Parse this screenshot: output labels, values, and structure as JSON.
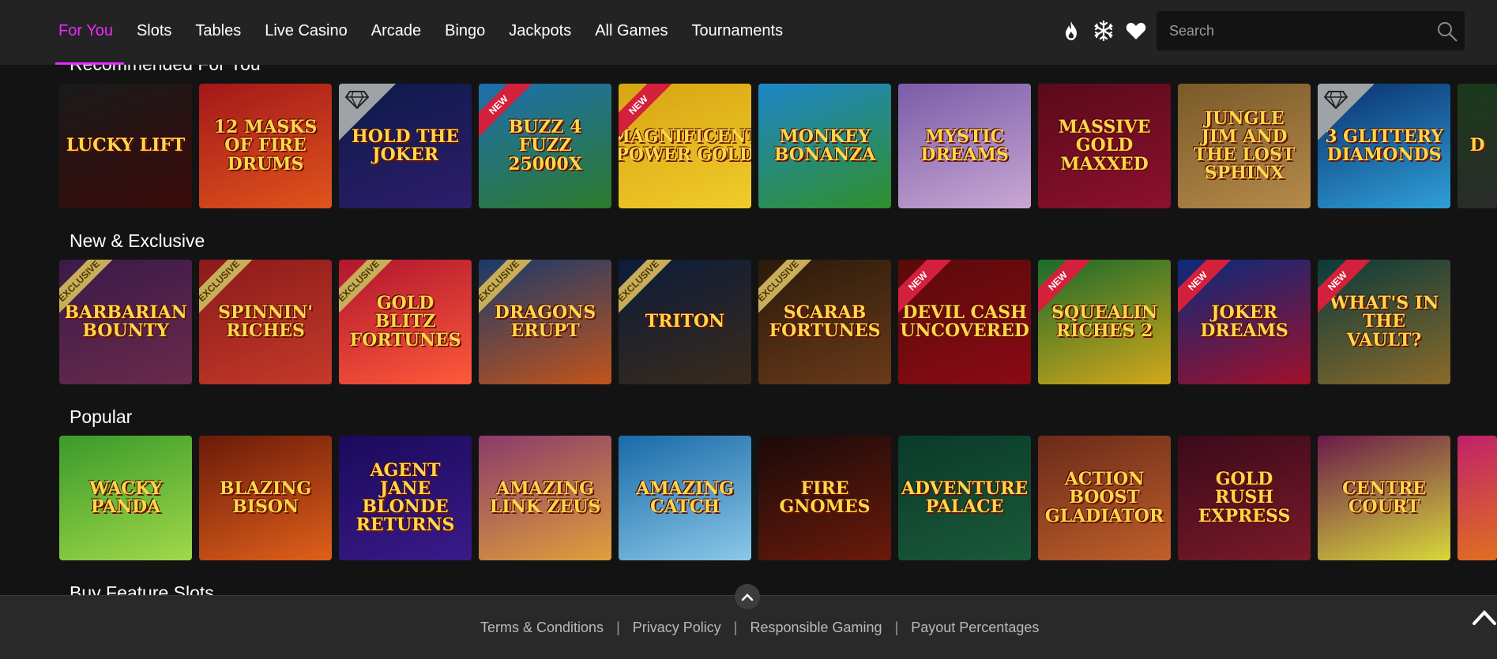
{
  "nav": {
    "items": [
      {
        "label": "For You",
        "active": true
      },
      {
        "label": "Slots",
        "active": false
      },
      {
        "label": "Tables",
        "active": false
      },
      {
        "label": "Live Casino",
        "active": false
      },
      {
        "label": "Arcade",
        "active": false
      },
      {
        "label": "Bingo",
        "active": false
      },
      {
        "label": "Jackpots",
        "active": false
      },
      {
        "label": "All Games",
        "active": false
      },
      {
        "label": "Tournaments",
        "active": false
      }
    ],
    "icons": [
      "flame-icon",
      "snowflake-icon",
      "heart-icon"
    ]
  },
  "search": {
    "placeholder": "Search"
  },
  "sections": [
    {
      "title": "Recommended For You",
      "games": [
        {
          "name": "Lucky Lift",
          "badge": "",
          "colors": [
            "#1a1a1a",
            "#3a0a0a"
          ]
        },
        {
          "name": "12 Masks of Fire Drums",
          "badge": "",
          "colors": [
            "#a3181a",
            "#e0541c"
          ]
        },
        {
          "name": "Hold the Joker",
          "badge": "diamond",
          "colors": [
            "#0c1a4a",
            "#2e1d6b"
          ]
        },
        {
          "name": "Buzz 4 Fuzz 25000x",
          "badge": "NEW",
          "colors": [
            "#1e6fb0",
            "#2c7a2a"
          ]
        },
        {
          "name": "Magnificent Power Gold",
          "badge": "NEW",
          "colors": [
            "#d8a514",
            "#f0cb2a"
          ]
        },
        {
          "name": "Monkey Bonanza",
          "badge": "",
          "colors": [
            "#1f86c9",
            "#2f8f2b"
          ]
        },
        {
          "name": "Mystic Dreams",
          "badge": "",
          "colors": [
            "#7a5ca8",
            "#c9a7d4"
          ]
        },
        {
          "name": "Massive Gold Maxxed",
          "badge": "",
          "colors": [
            "#5a0a1a",
            "#8c1030"
          ]
        },
        {
          "name": "Jungle Jim and the Lost Sphinx",
          "badge": "",
          "colors": [
            "#7a5a2a",
            "#b58a4a"
          ]
        },
        {
          "name": "3 Glittery Diamonds",
          "badge": "diamond",
          "colors": [
            "#0a2f6e",
            "#2fa0d8"
          ]
        },
        {
          "name": "D",
          "badge": "",
          "colors": [
            "#1a3a1a",
            "#2b2b2b"
          ]
        }
      ]
    },
    {
      "title": "New & Exclusive",
      "games": [
        {
          "name": "Barbarian Bounty",
          "badge": "EXCLUSIVE",
          "colors": [
            "#3a1a4a",
            "#6a2a4a"
          ]
        },
        {
          "name": "Spinnin' Riches",
          "badge": "EXCLUSIVE",
          "colors": [
            "#8a1a1a",
            "#c53a2a"
          ]
        },
        {
          "name": "Gold Blitz Fortunes",
          "badge": "EXCLUSIVE",
          "colors": [
            "#b0162e",
            "#ff5a3a"
          ]
        },
        {
          "name": "Dragons Erupt",
          "badge": "EXCLUSIVE",
          "colors": [
            "#1a3a6a",
            "#c2541a"
          ]
        },
        {
          "name": "Triton",
          "badge": "EXCLUSIVE",
          "colors": [
            "#0c1c3a",
            "#3a2a1a"
          ]
        },
        {
          "name": "Scarab Fortunes",
          "badge": "EXCLUSIVE",
          "colors": [
            "#2a1a0a",
            "#6a3a1a"
          ]
        },
        {
          "name": "Devil Cash Uncovered",
          "badge": "NEW",
          "colors": [
            "#5a0a0a",
            "#8a0a14"
          ]
        },
        {
          "name": "Squealin Riches 2",
          "badge": "NEW",
          "colors": [
            "#1a6a2a",
            "#d4a81a"
          ]
        },
        {
          "name": "Joker Dreams",
          "badge": "NEW",
          "colors": [
            "#0a2a7a",
            "#a0102a"
          ]
        },
        {
          "name": "What's in the Vault?",
          "badge": "NEW",
          "colors": [
            "#0a3a3a",
            "#8a6a2a"
          ]
        }
      ]
    },
    {
      "title": "Popular",
      "games": [
        {
          "name": "Wacky Panda",
          "badge": "",
          "colors": [
            "#3a9a2a",
            "#a0d84a"
          ]
        },
        {
          "name": "Blazing Bison",
          "badge": "",
          "colors": [
            "#6a1a0a",
            "#e0601a"
          ]
        },
        {
          "name": "Agent Jane Blonde Returns",
          "badge": "",
          "colors": [
            "#1a0a5a",
            "#3a1a8a"
          ]
        },
        {
          "name": "Amazing Link Zeus",
          "badge": "",
          "colors": [
            "#8a3a6a",
            "#e0a03a"
          ]
        },
        {
          "name": "Amazing Catch",
          "badge": "",
          "colors": [
            "#1a6aa8",
            "#8ac8e8"
          ]
        },
        {
          "name": "Fire Gnomes",
          "badge": "",
          "colors": [
            "#1a0a0a",
            "#6a1a0a"
          ]
        },
        {
          "name": "Adventure Palace",
          "badge": "",
          "colors": [
            "#0a3a2a",
            "#1a5a3a"
          ]
        },
        {
          "name": "Action Boost Gladiator",
          "badge": "",
          "colors": [
            "#6a2a1a",
            "#c0602a"
          ]
        },
        {
          "name": "Gold Rush Express",
          "badge": "",
          "colors": [
            "#3a0a1a",
            "#7a1a2a"
          ]
        },
        {
          "name": "Centre Court",
          "badge": "",
          "colors": [
            "#6a1a4a",
            "#d8d83a"
          ]
        },
        {
          "name": "",
          "badge": "",
          "colors": [
            "#c0206a",
            "#e07020"
          ]
        }
      ]
    },
    {
      "title": "Buy Feature Slots",
      "games": []
    }
  ],
  "footer": {
    "links": [
      "Terms & Conditions",
      "Privacy Policy",
      "Responsible Gaming",
      "Payout Percentages"
    ],
    "separator": "|"
  },
  "colors": {
    "accent": "#e82cff",
    "background": "#131313",
    "topbar": "#232323",
    "footer": "#292929"
  }
}
